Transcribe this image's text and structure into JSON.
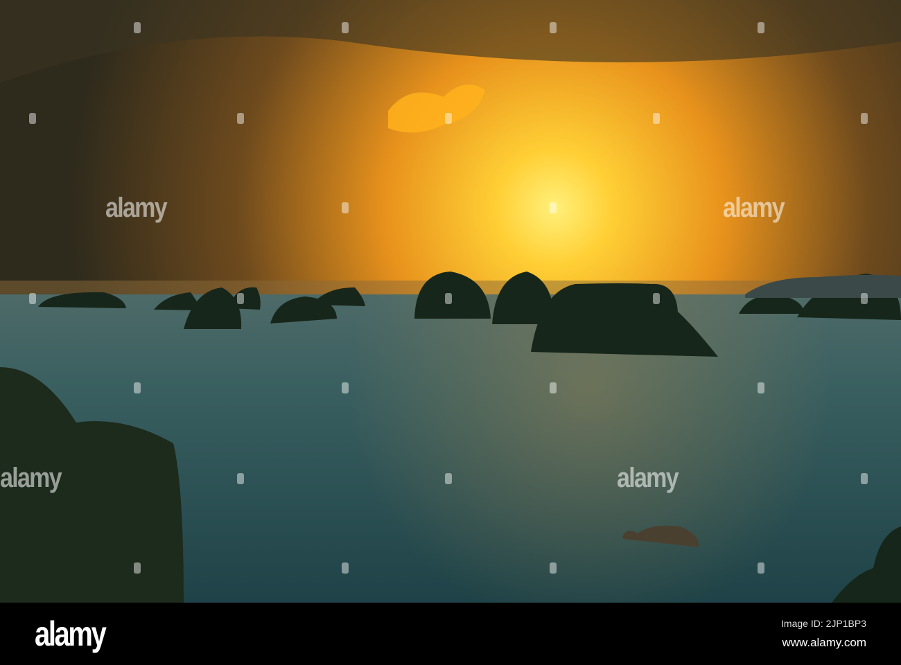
{
  "watermark": {
    "text": "alamy"
  },
  "footer": {
    "logo": "alamy",
    "image_id": "Image ID: 2JP1BP3",
    "url": "www.alamy.com"
  },
  "colors": {
    "sky_top": "#3b3520",
    "sun": "#ffd23a",
    "sea": "#2c5559",
    "island": "#17261a",
    "bar": "#000000"
  }
}
